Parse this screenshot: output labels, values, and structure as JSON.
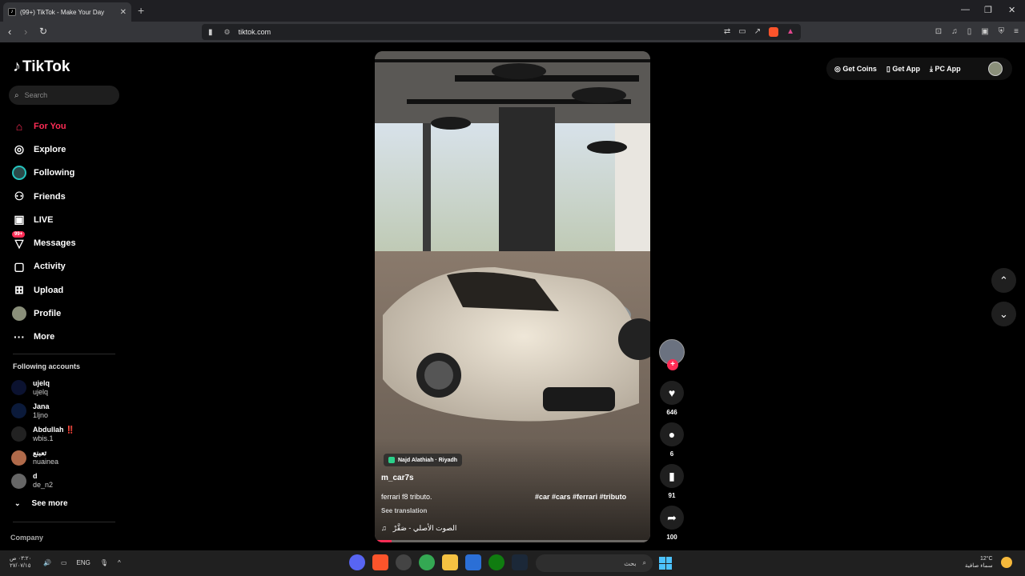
{
  "browser": {
    "tab_title": "(99+) TikTok - Make Your Day",
    "url": "tiktok.com"
  },
  "sidebar": {
    "logo": "TikTok",
    "search_placeholder": "Search",
    "nav": [
      {
        "label": "For You",
        "icon": "home-icon",
        "active": true
      },
      {
        "label": "Explore",
        "icon": "compass-icon"
      },
      {
        "label": "Following",
        "icon": "following-avatar-icon"
      },
      {
        "label": "Friends",
        "icon": "friends-icon"
      },
      {
        "label": "LIVE",
        "icon": "live-tv-icon"
      },
      {
        "label": "Messages",
        "icon": "messages-icon",
        "badge": "99+"
      },
      {
        "label": "Activity",
        "icon": "activity-icon"
      },
      {
        "label": "Upload",
        "icon": "upload-icon"
      },
      {
        "label": "Profile",
        "icon": "profile-avatar-icon"
      },
      {
        "label": "More",
        "icon": "more-dots-icon"
      }
    ],
    "following_title": "Following accounts",
    "accounts": [
      {
        "name": "ujelq",
        "handle": "ujelq",
        "color": "#0b1230"
      },
      {
        "name": "Jana",
        "handle": "1ljno",
        "color": "#0b1a3a"
      },
      {
        "name": "Abdullah ‼️",
        "handle": "wbis.1",
        "color": "#222"
      },
      {
        "name": "تعبنع",
        "handle": "nuainea",
        "color": "#b06a4a"
      },
      {
        "name": "d",
        "handle": "de_n2",
        "color": "#666"
      }
    ],
    "see_more": "See more",
    "company": "Company"
  },
  "video": {
    "location": "Najd Alathiah · Riyadh",
    "username": "m_car7s",
    "caption": "ferrari f8 tributo.",
    "hashtags": "#car #cars #ferrari #tributo",
    "see_translation": "See translation",
    "music": "الصوت الأصلي - صَقَّرْ",
    "progress": 0.06
  },
  "actions": {
    "likes": "646",
    "comments": "6",
    "saves": "91",
    "shares": "100"
  },
  "topbar": {
    "get_coins": "Get Coins",
    "get_app": "Get App",
    "pc_app": "PC App"
  },
  "taskbar": {
    "time": "٠٣:٢٠ ص",
    "date": "٢٧/٠٧/١٥",
    "lang": "ENG",
    "search_text": "بحث",
    "temp": "12°C",
    "weather": "سماء صافية"
  }
}
